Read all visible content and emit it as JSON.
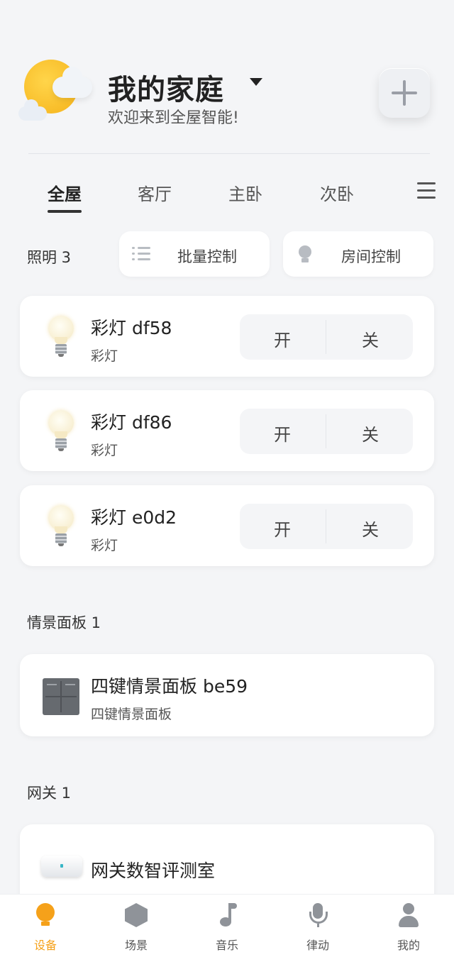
{
  "header": {
    "title": "我的家庭",
    "subtitle": "欢迎来到全屋智能!"
  },
  "tabs": [
    {
      "label": "全屋",
      "active": true
    },
    {
      "label": "客厅",
      "active": false
    },
    {
      "label": "主卧",
      "active": false
    },
    {
      "label": "次卧",
      "active": false
    }
  ],
  "lighting": {
    "label": "照明 3",
    "batch_control": "批量控制",
    "room_control": "房间控制",
    "devices": [
      {
        "name": "彩灯 df58",
        "type": "彩灯",
        "on": "开",
        "off": "关"
      },
      {
        "name": "彩灯 df86",
        "type": "彩灯",
        "on": "开",
        "off": "关"
      },
      {
        "name": "彩灯 e0d2",
        "type": "彩灯",
        "on": "开",
        "off": "关"
      }
    ]
  },
  "scene_panel": {
    "label": "情景面板 1",
    "devices": [
      {
        "name": "四键情景面板 be59",
        "type": "四键情景面板"
      }
    ]
  },
  "gateway": {
    "label": "网关 1",
    "devices": [
      {
        "name": "网关数智评测室"
      }
    ]
  },
  "bottom_nav": [
    {
      "label": "设备",
      "icon": "bulb-icon",
      "active": true
    },
    {
      "label": "场景",
      "icon": "cube-icon",
      "active": false
    },
    {
      "label": "音乐",
      "icon": "music-note-icon",
      "active": false
    },
    {
      "label": "律动",
      "icon": "microphone-icon",
      "active": false
    },
    {
      "label": "我的",
      "icon": "user-icon",
      "active": false
    }
  ],
  "colors": {
    "accent": "#f5a11a",
    "background": "#f4f5f7"
  }
}
